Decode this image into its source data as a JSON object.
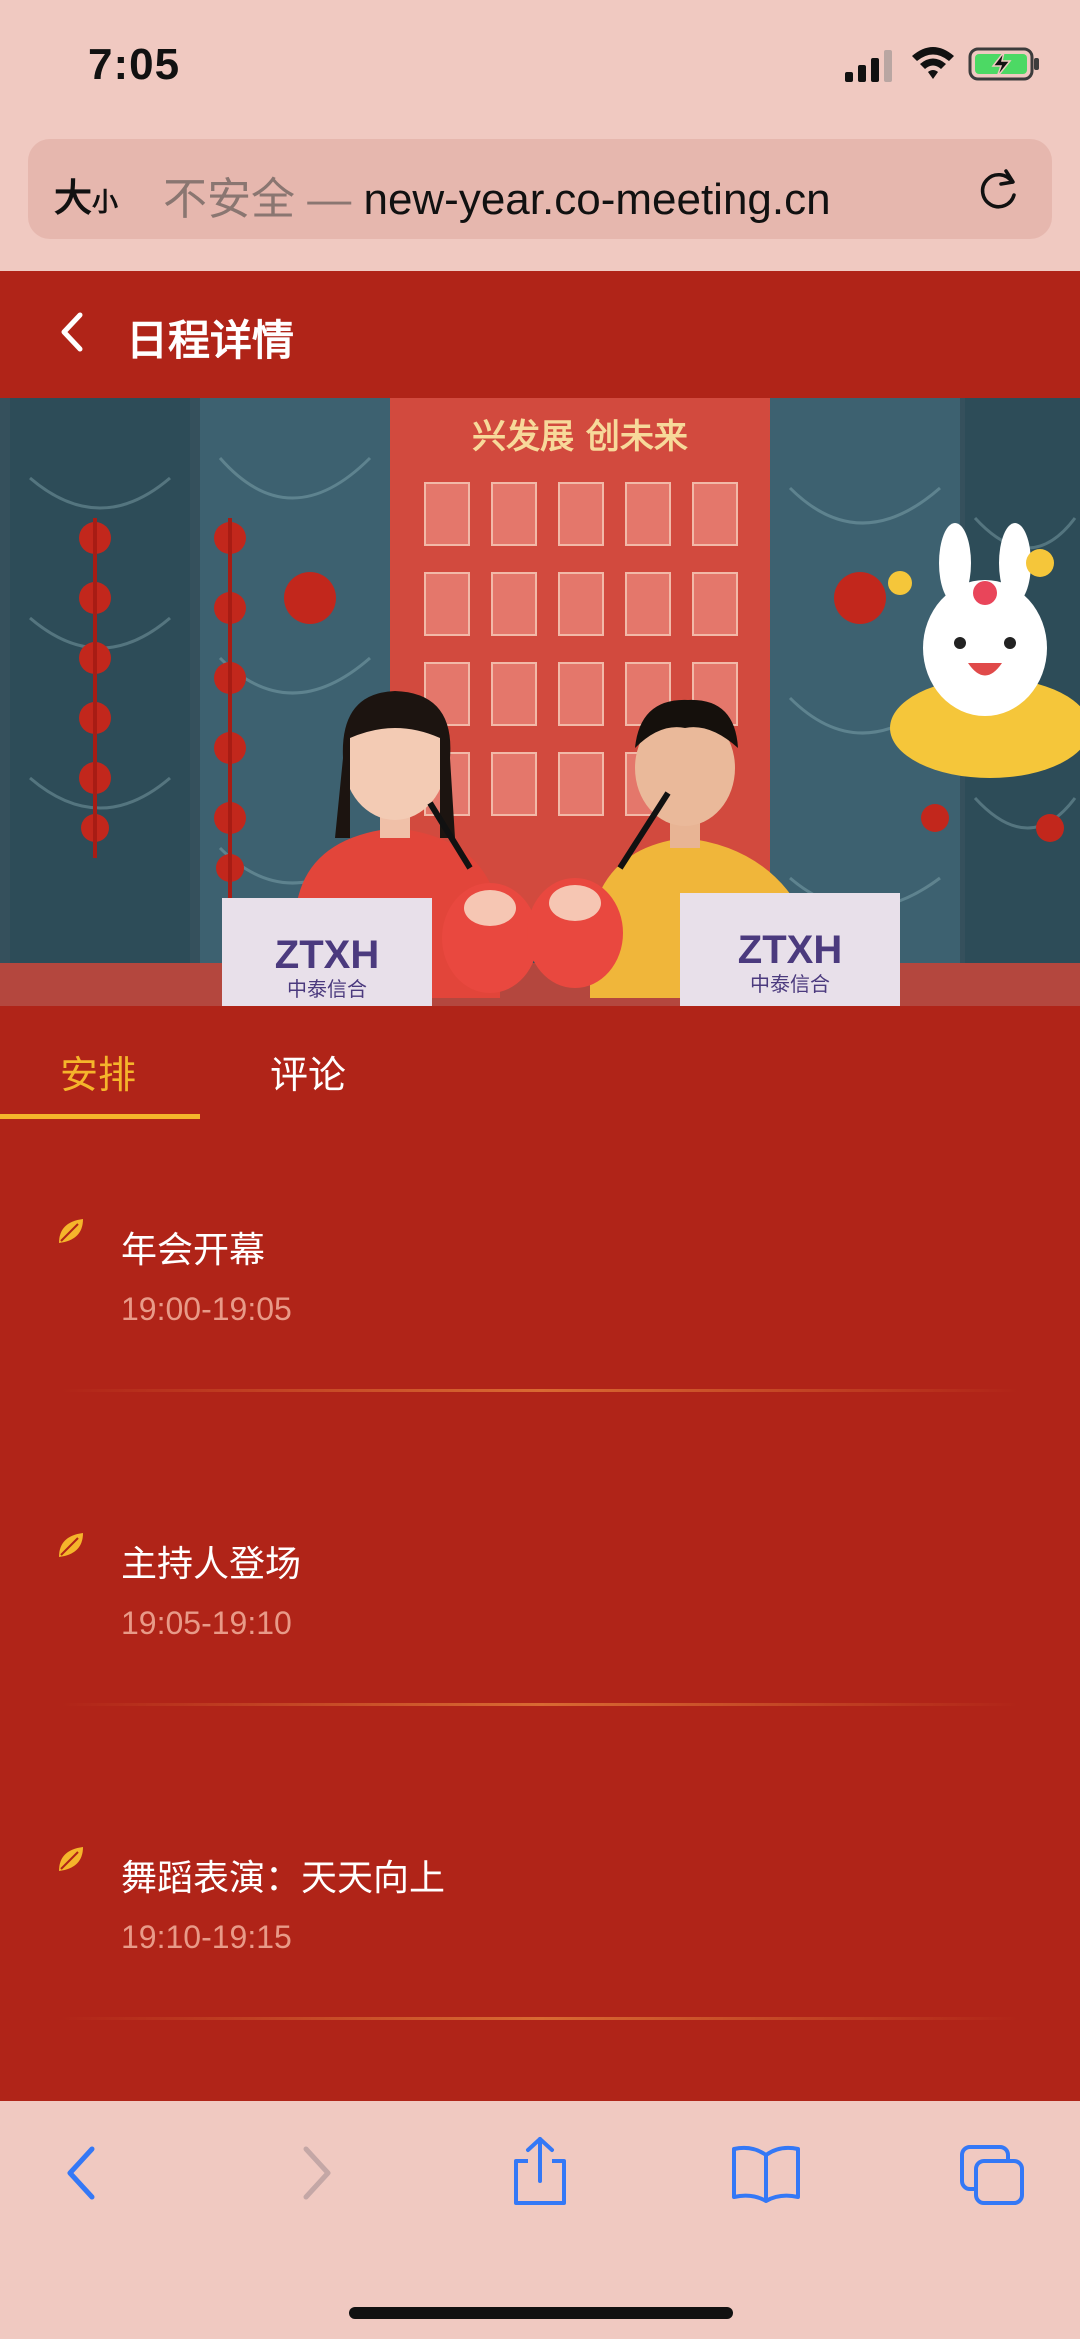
{
  "status_bar": {
    "time": "7:05",
    "icons": [
      "cellular-signal-icon",
      "wifi-icon",
      "battery-charging-icon"
    ]
  },
  "browser": {
    "text_size_label_big": "大",
    "text_size_label_small": "小",
    "insecure_label": "不安全",
    "separator": "—",
    "url": "new-year.co-meeting.cn"
  },
  "page": {
    "title": "日程详情"
  },
  "video": {
    "backdrop_text": "兴发展 创未来",
    "podium_logo": "ZTXH",
    "podium_caption": "中泰信合"
  },
  "tabs": [
    {
      "label": "安排",
      "active": true
    },
    {
      "label": "评论",
      "active": false
    }
  ],
  "schedule": [
    {
      "title": "年会开幕",
      "time": "19:00-19:05"
    },
    {
      "title": "主持人登场",
      "time": "19:05-19:10"
    },
    {
      "title": "舞蹈表演：天天向上",
      "time": "19:10-19:15"
    }
  ],
  "colors": {
    "page_red": "#b02418",
    "accent_gold": "#f5b52b",
    "time_pink": "#e89a88",
    "chrome_pink": "#f0c9c1",
    "ios_blue": "#3478f6"
  }
}
